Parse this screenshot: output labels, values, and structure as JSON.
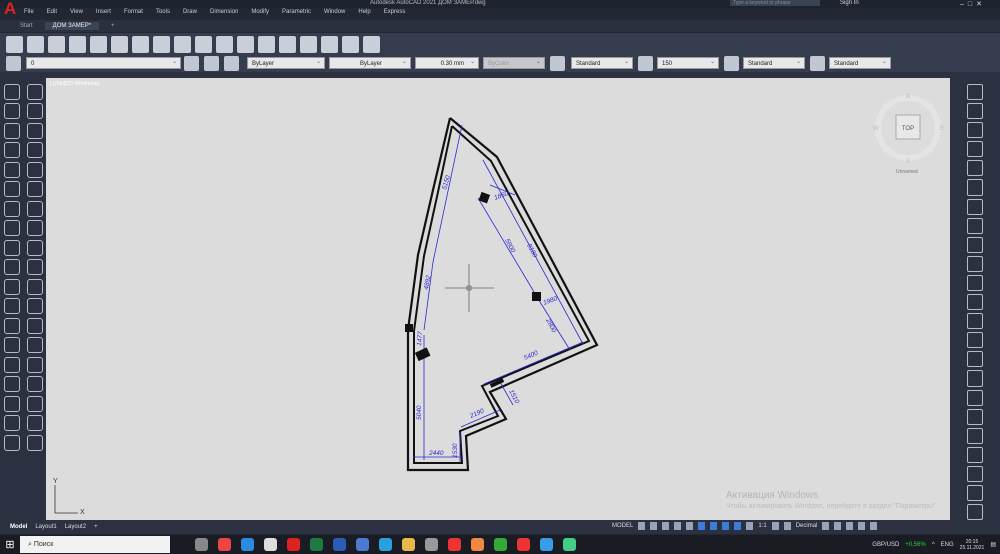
{
  "window": {
    "title": "Autodesk AutoCAD 2021   ДОМ ЗАМЕР.dwg",
    "search_placeholder": "Type a keyword or phrase",
    "sign_in": "Sign In"
  },
  "menu": [
    "File",
    "Edit",
    "View",
    "Insert",
    "Format",
    "Tools",
    "Draw",
    "Dimension",
    "Modify",
    "Parametric",
    "Window",
    "Help",
    "Express"
  ],
  "doc_tabs": [
    {
      "label": "Start",
      "active": false
    },
    {
      "label": "ДОМ ЗАМЕР*",
      "active": true
    }
  ],
  "toolbar": {
    "icons": [
      "new-icon",
      "open-icon",
      "save-icon",
      "print-icon",
      "plot-preview-icon",
      "publish-icon",
      "3d-print-icon",
      "block-editor-icon",
      "match-properties-icon",
      "undo-icon",
      "redo-icon",
      "properties-icon",
      "design-center-icon",
      "tool-palettes-icon",
      "sheet-set-icon",
      "markup-icon",
      "calculator-icon",
      "help-icon"
    ]
  },
  "properties_bar": {
    "layer": "0",
    "color": "ByLayer",
    "linetype": "ByLayer",
    "lineweight": "0.30 mm",
    "plotstyle": "ByColor",
    "text_style": "Standard",
    "dim_style": "150",
    "table_style": "Standard",
    "mleader_style": "Standard"
  },
  "viewport": {
    "label": "[-][Top][2D Wireframe]"
  },
  "viewcube": {
    "face": "TOP",
    "north": "N",
    "south": "S",
    "east": "E",
    "west": "W",
    "ucs": "Unnamed"
  },
  "drawing": {
    "wall_color": "#111111",
    "dim_color": "#2a2ad0",
    "dimensions": [
      "5150",
      "4892",
      "1860",
      "5600",
      "8180",
      "1980",
      "2800",
      "5400",
      "1477",
      "5040",
      "2190",
      "1510",
      "2440",
      "1530"
    ]
  },
  "ucs_icon": {
    "x": "X",
    "y": "Y"
  },
  "watermark": {
    "title": "Активация Windows",
    "text": "Чтобы активировать Windows, перейдите в раздел \"Параметры\"."
  },
  "layout_tabs": [
    {
      "label": "Model",
      "active": true
    },
    {
      "label": "Layout1",
      "active": false
    },
    {
      "label": "Layout2",
      "active": false
    },
    {
      "label": "+",
      "active": false
    }
  ],
  "statusbar": {
    "mode": "MODEL",
    "scale": "1:1",
    "units": "Decimal"
  },
  "taskbar": {
    "search": "Поиск",
    "ticker": "GBP/USD",
    "ticker_change": "+0,56%",
    "lang": "ENG",
    "time": "20:15",
    "date": "25.11.2021",
    "apps": [
      {
        "name": "task-view",
        "color": "#888"
      },
      {
        "name": "chrome",
        "color": "#e44"
      },
      {
        "name": "edge",
        "color": "#2a8be0"
      },
      {
        "name": "store",
        "color": "#ddd"
      },
      {
        "name": "autocad",
        "color": "#d22"
      },
      {
        "name": "excel",
        "color": "#1d7a45"
      },
      {
        "name": "word",
        "color": "#2b5cb8"
      },
      {
        "name": "files",
        "color": "#4a7bd0"
      },
      {
        "name": "telegram",
        "color": "#2aa0e0"
      },
      {
        "name": "explorer",
        "color": "#e8b84a"
      },
      {
        "name": "steam",
        "color": "#999"
      },
      {
        "name": "yandex",
        "color": "#e33"
      },
      {
        "name": "app",
        "color": "#e84"
      },
      {
        "name": "notes",
        "color": "#3a3"
      },
      {
        "name": "yandex-browser",
        "color": "#e33"
      },
      {
        "name": "app2",
        "color": "#3a9be8"
      },
      {
        "name": "app3",
        "color": "#4c8"
      }
    ]
  },
  "left_tools": [
    "line",
    "polyline",
    "circle",
    "arc",
    "rectangle",
    "polygon",
    "ellipse",
    "hatch",
    "spline",
    "point",
    "move",
    "copy",
    "rotate",
    "mirror",
    "stretch",
    "scale",
    "trim",
    "extend",
    "fillet",
    "chamfer",
    "array",
    "offset",
    "explode",
    "erase",
    "region",
    "table",
    "multiline-text",
    "block",
    "insert",
    "gradient",
    "wipeout",
    "revcloud",
    "boundary",
    "join",
    "break",
    "lengthen",
    "insert-block",
    "text"
  ],
  "right_tools": [
    "linear-dim",
    "text-a",
    "arc-dim",
    "text-b",
    "dim-radius",
    "spell-check",
    "angular",
    "text-style",
    "diameter",
    "text-edit",
    "ordinate",
    "dim-break",
    "baseline",
    "continue",
    "center-mark",
    "dim-space",
    "quick-dim",
    "tolerance",
    "jogged",
    "inspect",
    "oblique",
    "update",
    "dim-edit"
  ]
}
